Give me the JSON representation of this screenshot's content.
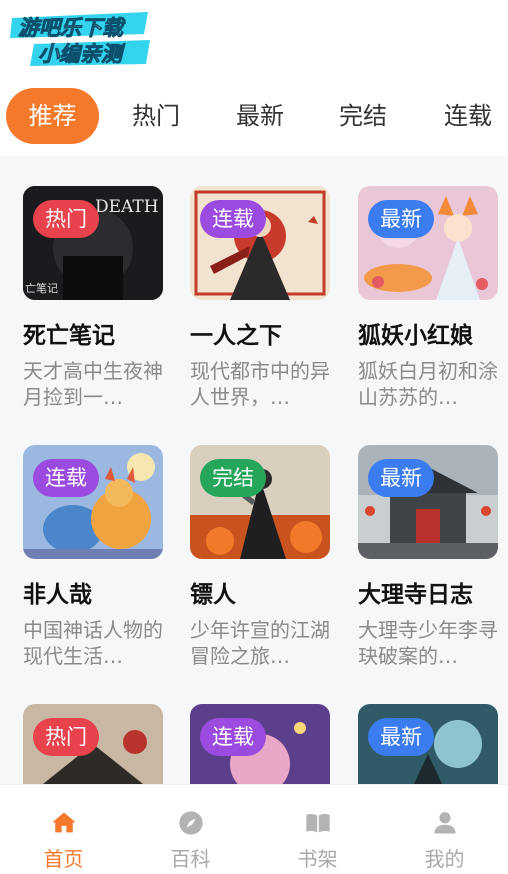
{
  "logo": {
    "line1": "游吧乐下载",
    "line2": "小编亲测"
  },
  "tabs": [
    {
      "label": "推荐",
      "active": true
    },
    {
      "label": "热门",
      "active": false
    },
    {
      "label": "最新",
      "active": false
    },
    {
      "label": "完结",
      "active": false
    },
    {
      "label": "连载",
      "active": false
    }
  ],
  "colors": {
    "accent": "#f5792a",
    "badge_hot": "#e8424c",
    "badge_serial": "#9b4be0",
    "badge_new": "#3b7cf0",
    "badge_done": "#26a65b"
  },
  "cards": [
    {
      "title": "死亡笔记",
      "desc": "天才高中生夜神月捡到一…",
      "badge": "热门",
      "badge_type": "hot",
      "cover_text": "DEATH NOTE",
      "cover_sub": "亡笔记"
    },
    {
      "title": "一人之下",
      "desc": "现代都市中的异人世界，…",
      "badge": "连载",
      "badge_type": "serial"
    },
    {
      "title": "狐妖小红娘",
      "desc": "狐妖白月初和涂山苏苏的…",
      "badge": "最新",
      "badge_type": "new"
    },
    {
      "title": "非人哉",
      "desc": "中国神话人物的现代生活…",
      "badge": "连载",
      "badge_type": "serial"
    },
    {
      "title": "镖人",
      "desc": "少年许宣的江湖冒险之旅…",
      "badge": "完结",
      "badge_type": "done"
    },
    {
      "title": "大理寺日志",
      "desc": "大理寺少年李寻玦破案的…",
      "badge": "最新",
      "badge_type": "new"
    },
    {
      "title": "",
      "desc": "",
      "badge": "热门",
      "badge_type": "hot"
    },
    {
      "title": "",
      "desc": "",
      "badge": "连载",
      "badge_type": "serial"
    },
    {
      "title": "",
      "desc": "",
      "badge": "最新",
      "badge_type": "new"
    }
  ],
  "nav": [
    {
      "label": "首页",
      "icon": "home-icon",
      "active": true
    },
    {
      "label": "百科",
      "icon": "compass-icon",
      "active": false
    },
    {
      "label": "书架",
      "icon": "book-icon",
      "active": false
    },
    {
      "label": "我的",
      "icon": "user-icon",
      "active": false
    }
  ]
}
